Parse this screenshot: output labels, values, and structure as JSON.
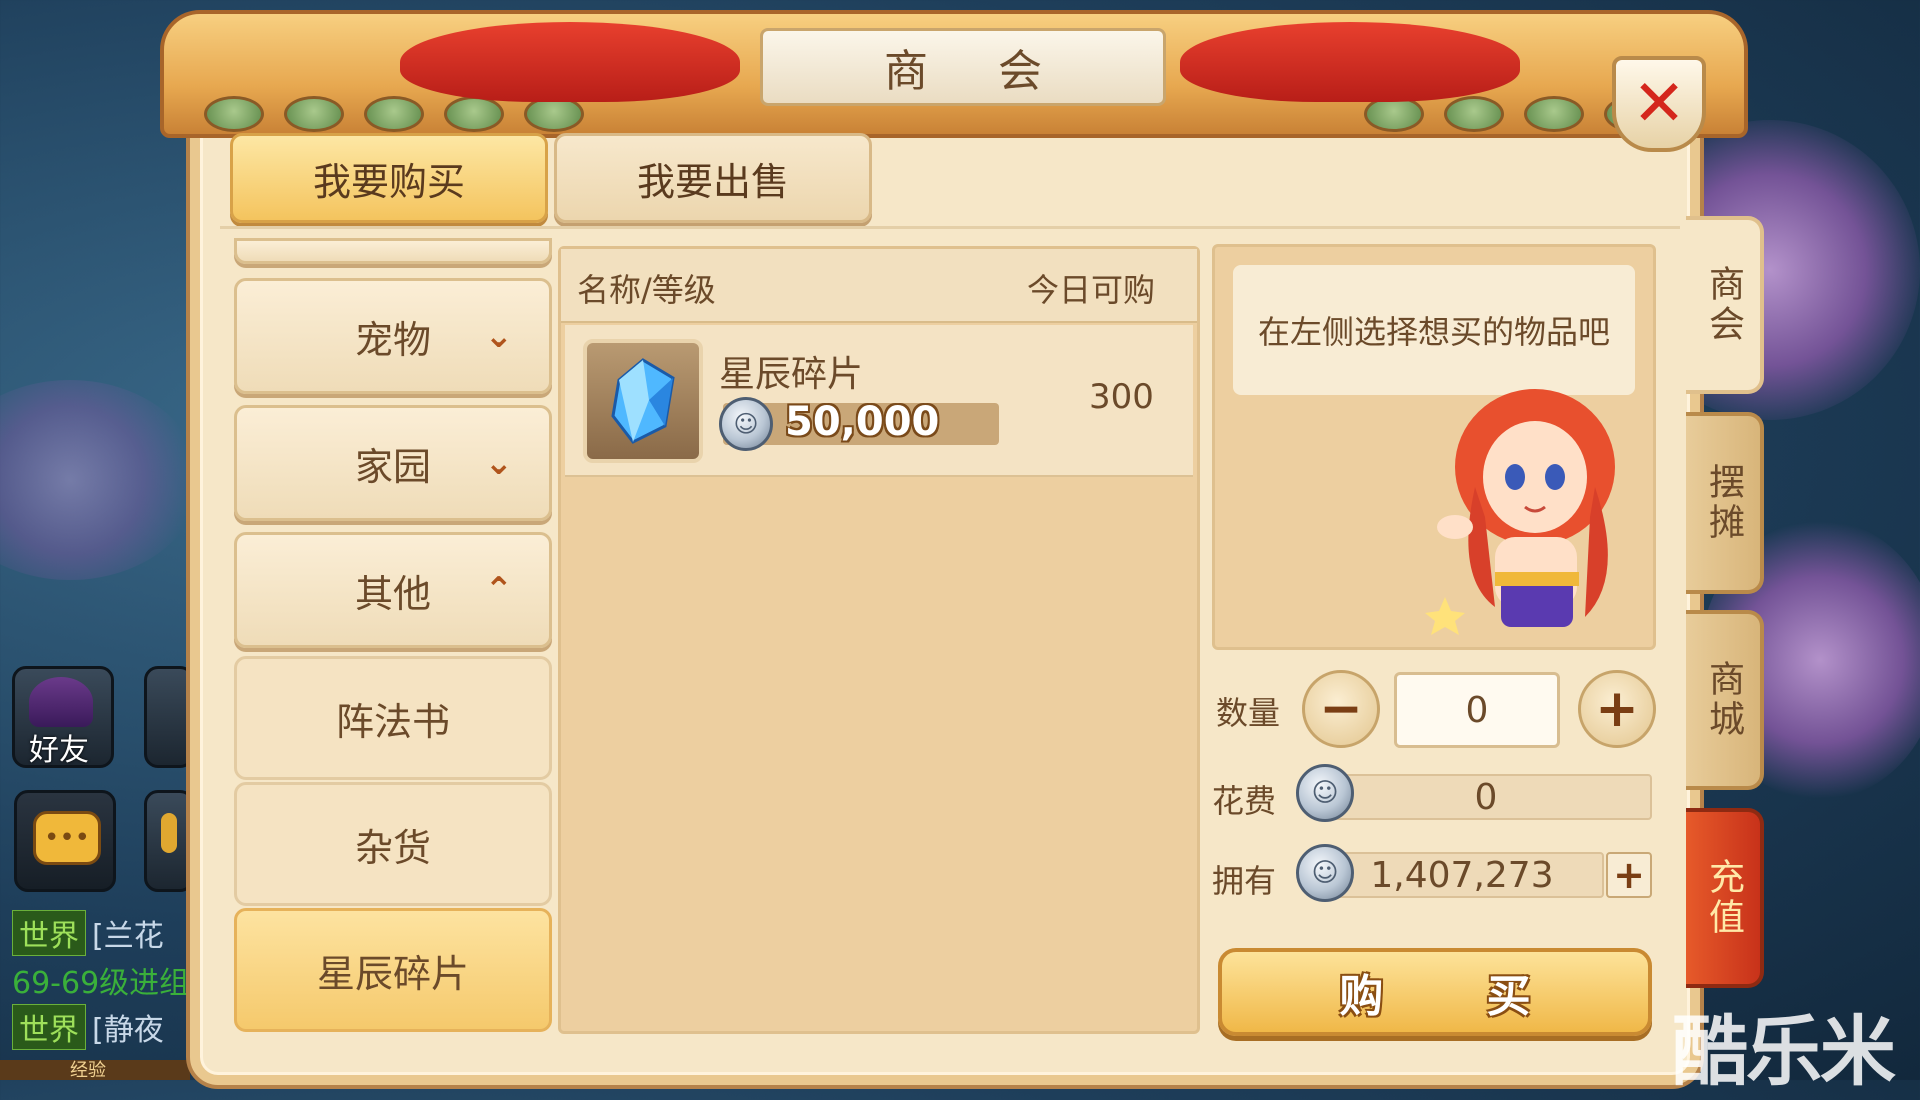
{
  "title": "商 会",
  "top_tabs": {
    "buy": "我要购买",
    "sell": "我要出售"
  },
  "categories": {
    "pet": "宠物",
    "home": "家园",
    "other": "其他",
    "sub": [
      "阵法书",
      "杂货",
      "星辰碎片"
    ]
  },
  "table": {
    "header_name": "名称/等级",
    "header_available": "今日可购",
    "rows": [
      {
        "name": "星辰碎片",
        "price": "50,000",
        "available": "300",
        "icon": "star-shard-crystal-icon"
      }
    ]
  },
  "npc_hint": "在左侧选择想买的物品吧",
  "purchase": {
    "qty_label": "数量",
    "qty_value": "0",
    "cost_label": "花费",
    "cost_value": "0",
    "own_label": "拥有",
    "own_value": "1,407,273",
    "buy_label": "购 买"
  },
  "side_tabs": [
    "商会",
    "摆摊",
    "商城",
    "充值"
  ],
  "hud": {
    "friends_label": "好友",
    "chat": [
      {
        "tag": "世界",
        "text": "[兰花"
      },
      {
        "text": "69-69级进组"
      },
      {
        "tag": "世界",
        "text": "[静夜"
      }
    ],
    "exp_label": "经验"
  },
  "watermark": "酷乐米",
  "colors": {
    "accent_gold": "#f4c45e",
    "panel_bg": "#f6e7c8",
    "close_red": "#d4261c",
    "recharge_red": "#d8421e"
  }
}
